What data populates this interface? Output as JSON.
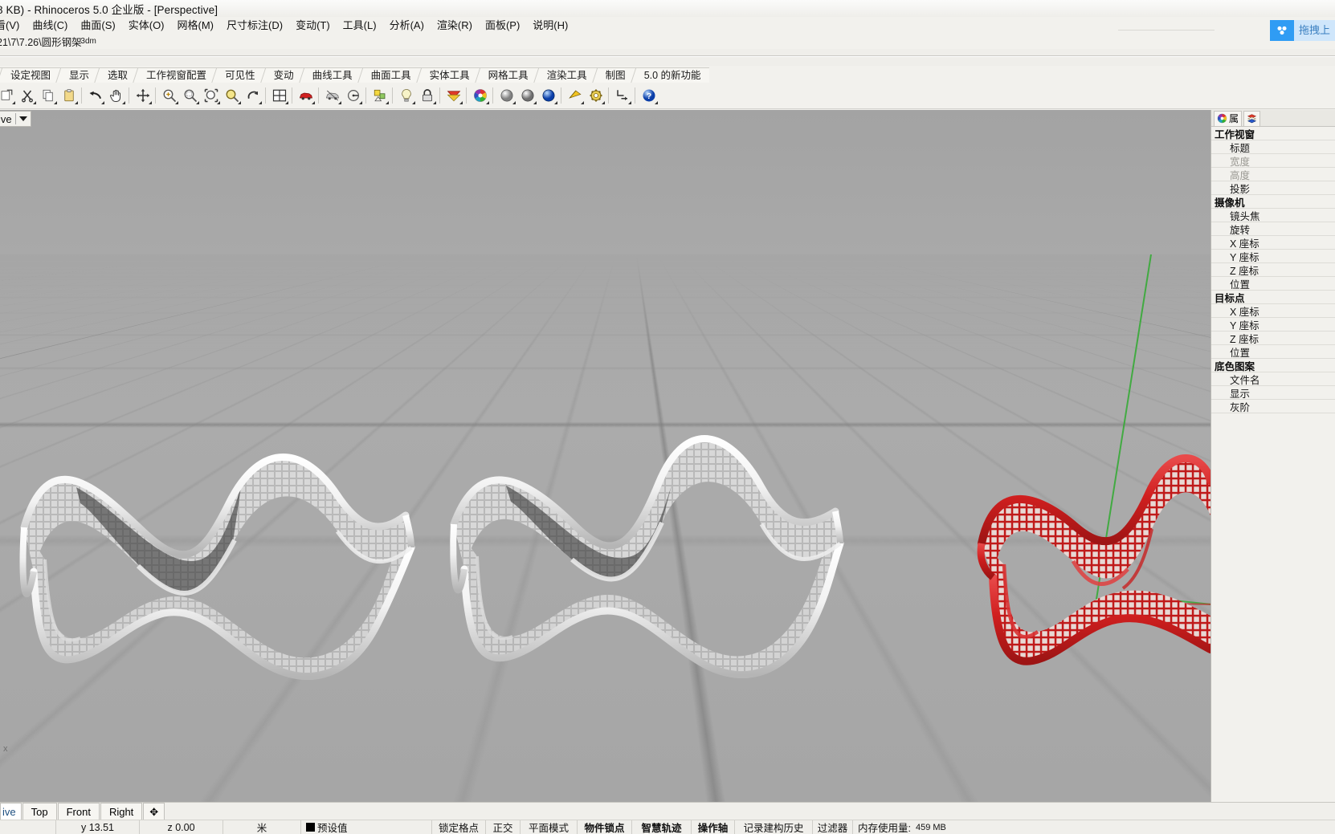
{
  "window": {
    "title": "8 KB) - Rhinoceros  5.0 企业版 - [Perspective]",
    "file_path": "21\\7\\7.26\\圆形钢架",
    "file_ext": ".3dm"
  },
  "menubar": {
    "items": [
      {
        "label": "看(V)",
        "name": "menu-view"
      },
      {
        "label": "曲线(C)",
        "name": "menu-curve"
      },
      {
        "label": "曲面(S)",
        "name": "menu-surface"
      },
      {
        "label": "实体(O)",
        "name": "menu-solid"
      },
      {
        "label": "网格(M)",
        "name": "menu-mesh"
      },
      {
        "label": "尺寸标注(D)",
        "name": "menu-dimension"
      },
      {
        "label": "变动(T)",
        "name": "menu-transform"
      },
      {
        "label": "工具(L)",
        "name": "menu-tools"
      },
      {
        "label": "分析(A)",
        "name": "menu-analyze"
      },
      {
        "label": "渲染(R)",
        "name": "menu-render"
      },
      {
        "label": "面板(P)",
        "name": "menu-panels"
      },
      {
        "label": "说明(H)",
        "name": "menu-help"
      }
    ]
  },
  "toolbar_tabs": {
    "items": [
      {
        "label": "设定视图",
        "name": "tab-set-view"
      },
      {
        "label": "显示",
        "name": "tab-display"
      },
      {
        "label": "选取",
        "name": "tab-select"
      },
      {
        "label": "工作视窗配置",
        "name": "tab-viewport-layout"
      },
      {
        "label": "可见性",
        "name": "tab-visibility"
      },
      {
        "label": "变动",
        "name": "tab-transform"
      },
      {
        "label": "曲线工具",
        "name": "tab-curve-tools"
      },
      {
        "label": "曲面工具",
        "name": "tab-surface-tools"
      },
      {
        "label": "实体工具",
        "name": "tab-solid-tools"
      },
      {
        "label": "网格工具",
        "name": "tab-mesh-tools"
      },
      {
        "label": "渲染工具",
        "name": "tab-render-tools"
      },
      {
        "label": "制图",
        "name": "tab-drafting"
      },
      {
        "label": "5.0 的新功能",
        "name": "tab-whats-new-50"
      }
    ]
  },
  "icon_toolbar": {
    "items": [
      {
        "name": "new-from-template-icon",
        "glyph": "⬓"
      },
      {
        "name": "cut-scissors-icon",
        "glyph": "✂"
      },
      {
        "name": "copy-icon",
        "glyph": "⧉"
      },
      {
        "name": "paste-clipboard-icon",
        "glyph": "📋"
      },
      {
        "name": "undo-arrow-icon",
        "glyph": "↩"
      },
      {
        "name": "pan-hand-icon",
        "glyph": "✋"
      },
      {
        "name": "move-arrows-icon",
        "glyph": "✥"
      },
      {
        "name": "zoom-in-icon",
        "glyph": "🔍"
      },
      {
        "name": "zoom-window-icon",
        "glyph": "🔍"
      },
      {
        "name": "zoom-extents-icon",
        "glyph": "🔍"
      },
      {
        "name": "zoom-selected-icon",
        "glyph": "🔍"
      },
      {
        "name": "rotate-view-icon",
        "glyph": "↻"
      },
      {
        "name": "four-viewport-icon",
        "glyph": "⊞"
      },
      {
        "name": "render-car-icon",
        "glyph": "🚗"
      },
      {
        "name": "render-preview-icon",
        "glyph": "🚘"
      },
      {
        "name": "sun-angle-icon",
        "glyph": "⊙"
      },
      {
        "name": "object-properties-icon",
        "glyph": "◳"
      },
      {
        "name": "light-bulb-icon",
        "glyph": "💡"
      },
      {
        "name": "lock-icon",
        "glyph": "🔒"
      },
      {
        "name": "layer-color-icon",
        "glyph": "◥"
      },
      {
        "name": "color-wheel-icon",
        "glyph": "◉"
      },
      {
        "name": "shaded-sphere-icon",
        "glyph": "⬤"
      },
      {
        "name": "rendered-sphere-icon",
        "glyph": "⬤"
      },
      {
        "name": "blue-sphere-icon",
        "glyph": "⬤"
      },
      {
        "name": "render-mesh-icon",
        "glyph": "◤"
      },
      {
        "name": "options-gear-icon",
        "glyph": "⚙"
      },
      {
        "name": "dimension-icon",
        "glyph": "⌐"
      },
      {
        "name": "help-icon",
        "glyph": "?"
      }
    ]
  },
  "viewport": {
    "tab_label": "ive",
    "axis_indicator": "x",
    "background_color": "#a6a6a6",
    "grid_major_color": "#787878",
    "grid_minor_color": "#919191",
    "y_axis_color": "#2faa2f",
    "x_axis_color": "#c03030"
  },
  "models": [
    {
      "name": "wavy-lattice-left",
      "color": "#ffffff",
      "description": "白色波浪网格钢架"
    },
    {
      "name": "wavy-lattice-center",
      "color": "#ffffff",
      "description": "白色波浪网格钢架"
    },
    {
      "name": "wavy-lattice-right-selected",
      "color": "#d02020",
      "description": "红色（选取中）波浪网格钢架"
    }
  ],
  "properties_panel": {
    "tabs": [
      {
        "name": "properties-tab",
        "label": "属",
        "icon": "color-wheel-icon"
      },
      {
        "name": "layers-tab",
        "label": "",
        "icon": "layer-icon"
      }
    ],
    "rows": [
      {
        "label": "工作视窗",
        "type": "group",
        "name": "prop-group-viewport"
      },
      {
        "label": "标题",
        "type": "field",
        "dim": false,
        "name": "prop-title"
      },
      {
        "label": "宽度",
        "type": "field",
        "dim": true,
        "name": "prop-width"
      },
      {
        "label": "高度",
        "type": "field",
        "dim": true,
        "name": "prop-height"
      },
      {
        "label": "投影",
        "type": "field",
        "dim": false,
        "name": "prop-projection"
      },
      {
        "label": "摄像机",
        "type": "group",
        "name": "prop-group-camera"
      },
      {
        "label": "镜头焦",
        "type": "field",
        "dim": false,
        "name": "prop-lens-length"
      },
      {
        "label": "旋转",
        "type": "field",
        "dim": false,
        "name": "prop-rotation"
      },
      {
        "label": "X 座标",
        "type": "field",
        "dim": false,
        "name": "prop-camera-x"
      },
      {
        "label": "Y 座标",
        "type": "field",
        "dim": false,
        "name": "prop-camera-y"
      },
      {
        "label": "Z 座标",
        "type": "field",
        "dim": false,
        "name": "prop-camera-z"
      },
      {
        "label": "位置",
        "type": "field",
        "dim": false,
        "name": "prop-camera-location"
      },
      {
        "label": "目标点",
        "type": "group",
        "name": "prop-group-target"
      },
      {
        "label": "X 座标",
        "type": "field",
        "dim": false,
        "name": "prop-target-x"
      },
      {
        "label": "Y 座标",
        "type": "field",
        "dim": false,
        "name": "prop-target-y"
      },
      {
        "label": "Z 座标",
        "type": "field",
        "dim": false,
        "name": "prop-target-z"
      },
      {
        "label": "位置",
        "type": "field",
        "dim": false,
        "name": "prop-target-location"
      },
      {
        "label": "底色图案",
        "type": "group",
        "name": "prop-group-wallpaper"
      },
      {
        "label": "文件名",
        "type": "field",
        "dim": false,
        "name": "prop-filename"
      },
      {
        "label": "显示",
        "type": "field",
        "dim": false,
        "name": "prop-show"
      },
      {
        "label": "灰阶",
        "type": "field",
        "dim": false,
        "name": "prop-grayscale"
      }
    ]
  },
  "view_tabs": {
    "items": [
      {
        "label": "ive",
        "name": "view-tab-perspective",
        "active": true,
        "cut": true
      },
      {
        "label": "Top",
        "name": "view-tab-top",
        "active": false
      },
      {
        "label": "Front",
        "name": "view-tab-front",
        "active": false
      },
      {
        "label": "Right",
        "name": "view-tab-right",
        "active": false
      },
      {
        "label": "✥",
        "name": "view-tab-add",
        "active": false
      }
    ]
  },
  "statusbar": {
    "coord_y": "y 13.51",
    "coord_z": "z 0.00",
    "units": "米",
    "layer": "预设值",
    "layer_color": "#000000",
    "toggles": [
      {
        "label": "锁定格点",
        "on": false,
        "name": "status-grid-snap"
      },
      {
        "label": "正交",
        "on": false,
        "name": "status-ortho"
      },
      {
        "label": "平面模式",
        "on": false,
        "name": "status-planar"
      },
      {
        "label": "物件锁点",
        "on": true,
        "name": "status-osnap"
      },
      {
        "label": "智慧轨迹",
        "on": true,
        "name": "status-smarttrack"
      },
      {
        "label": "操作轴",
        "on": true,
        "name": "status-gumball"
      },
      {
        "label": "记录建构历史",
        "on": false,
        "name": "status-record-history"
      },
      {
        "label": "过滤器",
        "on": false,
        "name": "status-filter"
      }
    ],
    "memory_label": "内存使用量:",
    "memory_value": "459 MB"
  },
  "baidu_widget": {
    "label": "拖拽上",
    "icon": "baidu-netdisk-icon",
    "icon_color": "#2f9cf4",
    "bg_color": "#cfe6fb"
  }
}
